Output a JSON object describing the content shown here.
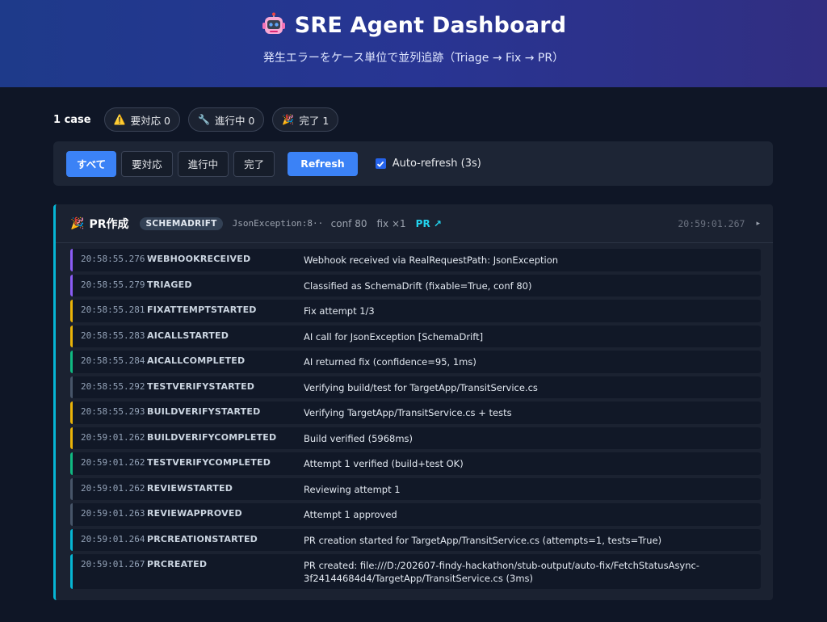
{
  "header": {
    "title": "SRE Agent Dashboard",
    "subtitle": "発生エラーをケース単位で並列追跡（Triage → Fix → PR）",
    "icon": "robot-icon"
  },
  "stats": {
    "case_count": "1 case",
    "pills": [
      {
        "icon": "⚠️",
        "label": "要対応 0"
      },
      {
        "icon": "🔧",
        "label": "進行中 0"
      },
      {
        "icon": "🎉",
        "label": "完了 1"
      }
    ]
  },
  "filters": {
    "buttons": [
      "すべて",
      "要対応",
      "進行中",
      "完了"
    ],
    "active_index": 0,
    "refresh_label": "Refresh",
    "auto_refresh_label": "Auto-refresh (3s)",
    "auto_refresh_checked": true
  },
  "case": {
    "status_icon": "🎉",
    "status": "PR作成",
    "type": "SCHEMADRIFT",
    "exception": "JsonException:8···",
    "confidence": "conf 80",
    "fix_count": "fix ×1",
    "pr_link": "PR ↗",
    "time": "20:59:01.267",
    "toggle": "▸",
    "accent_color": "#06b6d4",
    "events": [
      {
        "time": "20:58:55.276",
        "type": "WEBHOOKRECEIVED",
        "message": "Webhook received via RealRequestPath: JsonException",
        "color": "purple"
      },
      {
        "time": "20:58:55.279",
        "type": "TRIAGED",
        "message": "Classified as SchemaDrift (fixable=True, conf 80)",
        "color": "purple"
      },
      {
        "time": "20:58:55.281",
        "type": "FIXATTEMPTSTARTED",
        "message": "Fix attempt 1/3",
        "color": "yellow"
      },
      {
        "time": "20:58:55.283",
        "type": "AICALLSTARTED",
        "message": "AI call for JsonException [SchemaDrift]",
        "color": "yellow"
      },
      {
        "time": "20:58:55.284",
        "type": "AICALLCOMPLETED",
        "message": "AI returned fix (confidence=95, 1ms)",
        "color": "green"
      },
      {
        "time": "20:58:55.292",
        "type": "TESTVERIFYSTARTED",
        "message": "Verifying build/test for TargetApp/TransitService.cs",
        "color": "gray"
      },
      {
        "time": "20:58:55.293",
        "type": "BUILDVERIFYSTARTED",
        "message": "Verifying TargetApp/TransitService.cs + tests",
        "color": "yellow"
      },
      {
        "time": "20:59:01.262",
        "type": "BUILDVERIFYCOMPLETED",
        "message": "Build verified (5968ms)",
        "color": "yellow"
      },
      {
        "time": "20:59:01.262",
        "type": "TESTVERIFYCOMPLETED",
        "message": "Attempt 1 verified (build+test OK)",
        "color": "green"
      },
      {
        "time": "20:59:01.262",
        "type": "REVIEWSTARTED",
        "message": "Reviewing attempt 1",
        "color": "gray"
      },
      {
        "time": "20:59:01.263",
        "type": "REVIEWAPPROVED",
        "message": "Attempt 1 approved",
        "color": "gray"
      },
      {
        "time": "20:59:01.264",
        "type": "PRCREATIONSTARTED",
        "message": "PR creation started for TargetApp/TransitService.cs (attempts=1, tests=True)",
        "color": "cyan"
      },
      {
        "time": "20:59:01.267",
        "type": "PRCREATED",
        "message": "PR created: file:///D:/202607-findy-hackathon/stub-output/auto-fix/FetchStatusAsync-3f24144684d4/TargetApp/TransitService.cs (3ms)",
        "color": "cyan"
      }
    ]
  }
}
